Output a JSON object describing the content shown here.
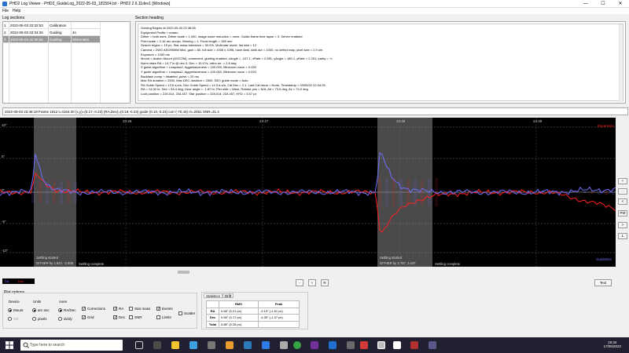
{
  "window": {
    "title": "PHD2 Log Viewer - PHD2_GuideLog_2022-05-03_181504.txt - PHD2 2.6.11dev1 [Windows]",
    "minimize": "—",
    "maximize": "☐",
    "close": "✕"
  },
  "menu": {
    "file": "File",
    "help": "Help"
  },
  "log_sections": {
    "label": "Log sections",
    "rows": [
      {
        "no": "1",
        "timestamp": "2022-05-03 22:32:53",
        "type": "Calibration",
        "value": ""
      },
      {
        "no": "2",
        "timestamp": "2022-05-03 22:34:26",
        "type": "Guiding",
        "value": "4s"
      },
      {
        "no": "3",
        "timestamp": "2022-05-03 22:36:55",
        "type": "Guiding",
        "value": "3h51m56s"
      }
    ]
  },
  "section_heading": {
    "label": "Section heading",
    "lines": [
      "Guiding Begins at 2022-05-03 22:36:55",
      "Equipment Profile = maaro",
      "Dither = both axes, Dither scale = 1.000, Image noise reduction = none, Guide-frame time lapse = 0, Server enabled",
      "Pixel scale = 3.16 arc-sec/px, Binning = 1, Focal length = 198 mm",
      "Search region = 15 px, Star mass tolerance = 50.0%, Multi-star mode, list size = 12",
      "Camera = ZWO ASI290MM Mini, gain = 80, full size = 1936 x 1096, have dark, dark dur = 1000, no defect map, pixel size = 2.9 um",
      "Exposure = 1000 ms",
      "Mount = Avalon Mount (ASCOM), connected, guiding enabled, xAngle = -107.1, xRate = 2.691, yAngle = 180.1, yRate = 2.251, parity = +/-",
      "Norm rates RA = 14.7\"/s @ dec 0, Dec = 15.0\"/s; ortho err. = 2.8 deg",
      "X guide algorithm = Lowpass2, Aggressiveness = 100.000, Minimum move = 0.020",
      "Y guide algorithm = Lowpass2, Aggressiveness = 100.000, Minimum move = 0.020",
      "Backlash comp = disabled, pulse = 20 ms",
      "Max RA duration = 2500, Max DEC duration = 2500, DEC guide mode = Auto",
      "RA Guide Speed = 13.5 a-s/s, Dec Guide Speed = 14.3 a-s/s, Cal Dec = 2.1, Last Cal Issue = None, Timestamp = 03/05/22 22:34:26",
      "RA = 14.00 hr, Dec = 54.4 deg, Hour angle = -1.87 hr, Pier side = West, Rotator pos = N/A, Alt = 73.5 deg, Az = 74.0 deg",
      "Lock position = 228.014, 234.457, Star position = 228.014, 234.457, HFD = 3.57 px"
    ]
  },
  "info_bar": "2022-05-03 23:46:19 Frame 1612 t=4164.30 (x,y)=(0.17,-0.23) (RA,Dec)=(0.19,-0.23) guide (0.10,-0.23) corr (-70,44) m=2451 SNR=31.4",
  "graph": {
    "time_labels": [
      "23:46",
      "23:47",
      "23:48",
      "23:49"
    ],
    "y_labels": [
      "10\"",
      "5\"",
      "0\"",
      "-5\"",
      "-10\""
    ],
    "legend_top": "Expansion",
    "legend_bottom": "GuideDec",
    "annotations": [
      {
        "label": "Settling started",
        "sub": "DITHER by 1.622, -2.908"
      },
      {
        "label": "Settling complete"
      },
      {
        "label": "Settling started",
        "sub": "DITHER by 2.797, 3.437"
      },
      {
        "label": "Settling complete"
      }
    ],
    "colors": {
      "ra": "#6e6eff",
      "dec": "#ff2020",
      "settle": "#4a4a4a"
    }
  },
  "side_buttons": [
    "+",
    "-",
    "<",
    ">",
    "PIZ",
    "L"
  ],
  "nav_buttons": [
    "-",
    "+",
    "R"
  ],
  "text_button": "Text",
  "legend_box": {
    "ra": "RA",
    "dec": "Dec"
  },
  "plot_options": {
    "label": "Plot options",
    "device": {
      "label": "Device",
      "options": [
        "Mount",
        "AO"
      ],
      "selected": "Mount"
    },
    "units": {
      "label": "Units",
      "options": [
        "arc-sec",
        "pixels"
      ],
      "selected": "arc-sec"
    },
    "axes": {
      "label": "Axes",
      "options": [
        "RA/Dec",
        "dx/dy"
      ],
      "selected": "RA/Dec"
    },
    "checks": [
      {
        "label": "Corrections",
        "checked": true
      },
      {
        "label": "Grid",
        "checked": true
      },
      {
        "label": "RA",
        "checked": true
      },
      {
        "label": "Dec",
        "checked": true
      },
      {
        "label": "Star mass",
        "checked": false
      },
      {
        "label": "SNR",
        "checked": false
      },
      {
        "label": "Events",
        "checked": true
      },
      {
        "label": "Limits",
        "checked": false
      },
      {
        "label": "Scatter",
        "checked": false
      }
    ]
  },
  "statistics": {
    "tabs": [
      "Statistics",
      "Drift"
    ],
    "headers": [
      "",
      "RMS",
      "Peak"
    ],
    "rows": [
      [
        "RA",
        "0.68\" (0.21 px)",
        "-5.13\" (-1.61 px)"
      ],
      [
        "Dec",
        "0.56\" (0.17 px)",
        "-4.35\" (-1.37 px)"
      ],
      [
        "Total",
        "0.88\" (0.28 px)",
        ""
      ]
    ]
  },
  "taskbar": {
    "search_placeholder": "Type here to search",
    "time": "19:34",
    "date": "17/05/2022"
  }
}
